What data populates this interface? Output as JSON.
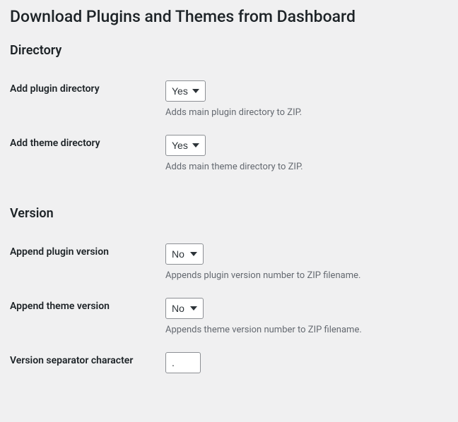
{
  "page": {
    "title": "Download Plugins and Themes from Dashboard"
  },
  "sections": {
    "directory": {
      "heading": "Directory",
      "add_plugin_directory": {
        "label": "Add plugin directory",
        "value": "Yes",
        "description": "Adds main plugin directory to ZIP."
      },
      "add_theme_directory": {
        "label": "Add theme directory",
        "value": "Yes",
        "description": "Adds main theme directory to ZIP."
      }
    },
    "version": {
      "heading": "Version",
      "append_plugin_version": {
        "label": "Append plugin version",
        "value": "No",
        "description": "Appends plugin version number to ZIP filename."
      },
      "append_theme_version": {
        "label": "Append theme version",
        "value": "No",
        "description": "Appends theme version number to ZIP filename."
      },
      "version_separator": {
        "label": "Version separator character",
        "value": "."
      }
    }
  },
  "options": {
    "yes": "Yes",
    "no": "No"
  }
}
